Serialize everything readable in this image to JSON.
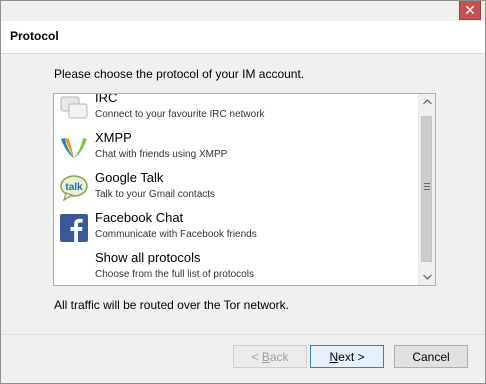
{
  "window": {
    "close_glyph": "✕"
  },
  "header": {
    "title": "Protocol"
  },
  "prompt": "Please choose the protocol of your IM account.",
  "protocols": [
    {
      "name": "IRC",
      "description": "Connect to your favourite IRC network",
      "icon": "irc-icon"
    },
    {
      "name": "XMPP",
      "description": "Chat with friends using XMPP",
      "icon": "xmpp-icon"
    },
    {
      "name": "Google Talk",
      "description": "Talk to your Gmail contacts",
      "icon": "google-talk-icon"
    },
    {
      "name": "Facebook Chat",
      "description": "Communicate with Facebook friends",
      "icon": "facebook-icon"
    },
    {
      "name": "Show all protocols",
      "description": "Choose from the full list of protocols",
      "icon": ""
    }
  ],
  "footer_note": "All traffic will be routed over the Tor network.",
  "buttons": {
    "back_prefix": "< ",
    "back_key": "B",
    "back_rest": "ack",
    "next_key": "N",
    "next_rest": "ext >",
    "cancel": "Cancel"
  }
}
